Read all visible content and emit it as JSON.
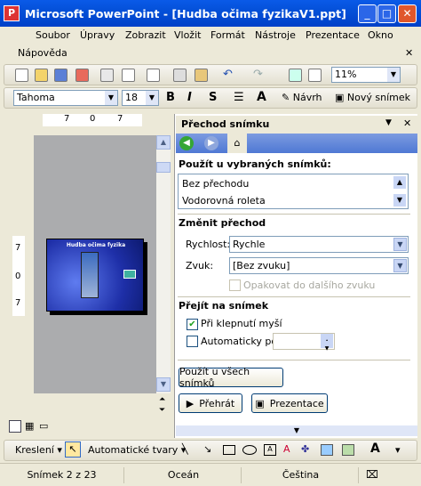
{
  "window": {
    "title": "Microsoft PowerPoint - [Hudba očima fyzikaV1.ppt]"
  },
  "menu": [
    "Soubor",
    "Úpravy",
    "Zobrazit",
    "Vložit",
    "Formát",
    "Nástroje",
    "Prezentace",
    "Okno",
    "Nápověda"
  ],
  "toolbar": {
    "zoom": "11%"
  },
  "formatting": {
    "font": "Tahoma",
    "size": "18",
    "bold": "B",
    "italic": "I",
    "shadow": "S",
    "design_label": "Návrh",
    "new_slide_label": "Nový snímek"
  },
  "ruler": {
    "top_values": [
      "7",
      "0",
      "7"
    ],
    "left_values": [
      "7",
      "0",
      "7"
    ]
  },
  "slide": {
    "title": "Hudba očima fyzika"
  },
  "pane": {
    "title": "Přechod snímku",
    "apply_section": "Použít u vybraných snímků:",
    "transitions": [
      "Bez přechodu",
      "Vodorovná roleta"
    ],
    "modify_section": "Změnit přechod",
    "speed_label": "Rychlost:",
    "speed_value": "Rychle",
    "sound_label": "Zvuk:",
    "sound_value": "[Bez zvuku]",
    "loop_label": "Opakovat do dalšího zvuku",
    "advance_section": "Přejít na snímek",
    "on_click_label": "Při klepnutí myší",
    "on_click_checked": true,
    "auto_label": "Automaticky po",
    "apply_all_label": "Použít u všech snímků",
    "play_label": "Přehrát",
    "slideshow_label": "Prezentace"
  },
  "drawing": {
    "draw_label": "Kreslení",
    "autoshapes_label": "Automatické tvary"
  },
  "status": {
    "slide": "Snímek 2 z 23",
    "design": "Oceán",
    "language": "Čeština"
  },
  "colors": {
    "titlebar": "#0450d8",
    "pane_bg": "#ffffff",
    "chrome": "#ece9d8"
  }
}
